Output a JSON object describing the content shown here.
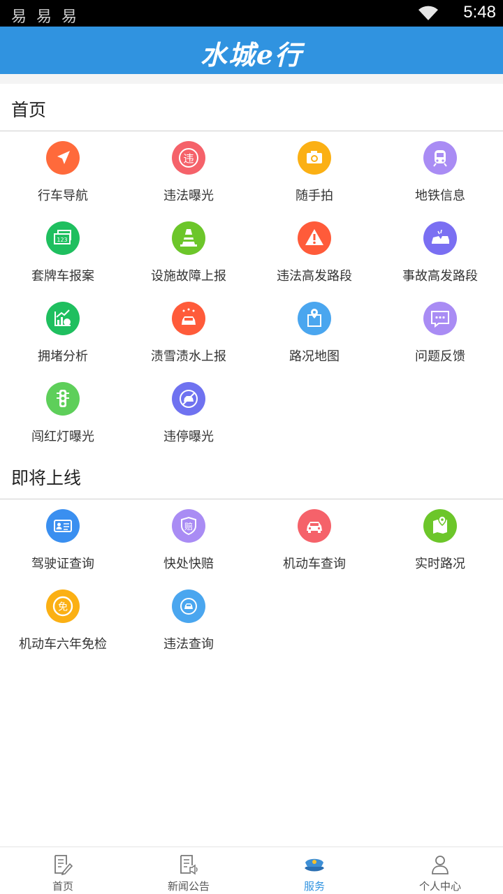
{
  "status_bar": {
    "notification_icons": [
      "易",
      "易",
      "易"
    ],
    "wifi_icon": "wifi-icon",
    "time": "5:48"
  },
  "header": {
    "title": "水城e行"
  },
  "sections": [
    {
      "title": "首页",
      "items": [
        {
          "label": "行车导航",
          "icon": "navigation-arrow-icon",
          "color": "#ff6a3b"
        },
        {
          "label": "违法曝光",
          "icon": "violation-badge-icon",
          "color": "#f5626a"
        },
        {
          "label": "随手拍",
          "icon": "camera-icon",
          "color": "#fbb014"
        },
        {
          "label": "地铁信息",
          "icon": "subway-icon",
          "color": "#a98cf4"
        },
        {
          "label": "套牌车报案",
          "icon": "license-plate-icon",
          "color": "#1fbf5f"
        },
        {
          "label": "设施故障上报",
          "icon": "traffic-cone-icon",
          "color": "#6cc62a"
        },
        {
          "label": "违法高发路段",
          "icon": "warning-icon",
          "color": "#ff5b3a"
        },
        {
          "label": "事故高发路段",
          "icon": "car-accident-icon",
          "color": "#7a6ff2"
        },
        {
          "label": "拥堵分析",
          "icon": "congestion-chart-icon",
          "color": "#1fbf5f"
        },
        {
          "label": "渍雪渍水上报",
          "icon": "snow-car-icon",
          "color": "#ff5b3a"
        },
        {
          "label": "路况地图",
          "icon": "map-pin-icon",
          "color": "#4aa6ef"
        },
        {
          "label": "问题反馈",
          "icon": "chat-bubble-icon",
          "color": "#a98cf4"
        },
        {
          "label": "闯红灯曝光",
          "icon": "traffic-light-icon",
          "color": "#5ecf5a"
        },
        {
          "label": "违停曝光",
          "icon": "no-parking-car-icon",
          "color": "#6f72f0"
        }
      ]
    },
    {
      "title": "即将上线",
      "items": [
        {
          "label": "驾驶证查询",
          "icon": "driver-license-icon",
          "color": "#3a8ff0"
        },
        {
          "label": "快处快赔",
          "icon": "compensation-shield-icon",
          "color": "#a98cf4"
        },
        {
          "label": "机动车查询",
          "icon": "car-front-icon",
          "color": "#f5626a"
        },
        {
          "label": "实时路况",
          "icon": "map-location-icon",
          "color": "#6cc62a"
        },
        {
          "label": "机动车六年免检",
          "icon": "exemption-badge-icon",
          "color": "#fbb014"
        },
        {
          "label": "违法查询",
          "icon": "violation-search-icon",
          "color": "#4aa6ef"
        }
      ]
    }
  ],
  "icon_glyphs": {
    "violation": "违",
    "compensation": "赔",
    "exemption": "免",
    "plate": "123"
  },
  "bottom_nav": [
    {
      "label": "首页",
      "icon": "home-document-icon",
      "active": false
    },
    {
      "label": "新闻公告",
      "icon": "news-icon",
      "active": false
    },
    {
      "label": "服务",
      "icon": "police-cap-icon",
      "active": true
    },
    {
      "label": "个人中心",
      "icon": "person-icon",
      "active": false
    }
  ],
  "colors": {
    "brand": "#3093e0",
    "active_nav": "#3093e0",
    "inactive_nav": "#555555"
  }
}
